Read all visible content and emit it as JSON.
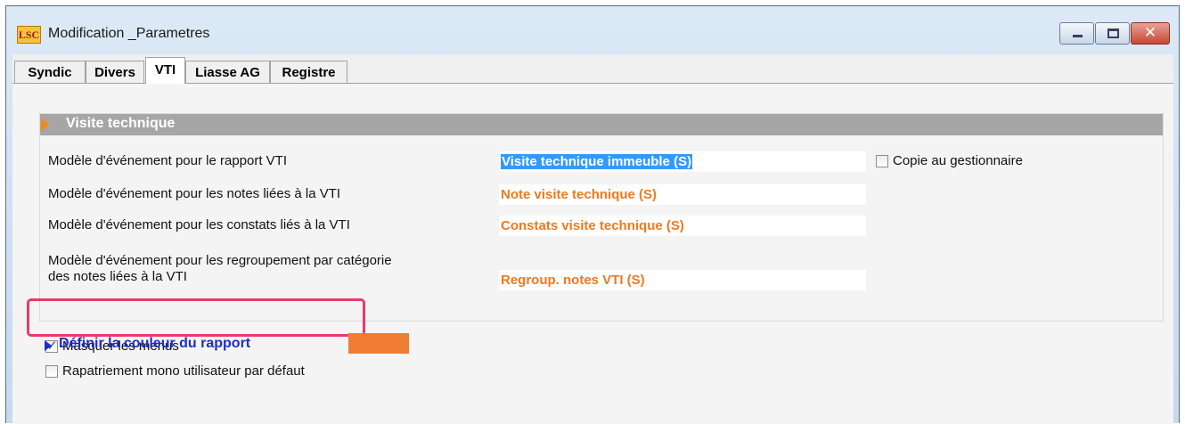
{
  "window": {
    "app_icon_text": "LSC",
    "title": "Modification _Parametres"
  },
  "tabs": [
    {
      "label": "Syndic",
      "active": false
    },
    {
      "label": "Divers",
      "active": false
    },
    {
      "label": "VTI",
      "active": true
    },
    {
      "label": "Liasse AG",
      "active": false
    },
    {
      "label": "Registre",
      "active": false
    }
  ],
  "section": {
    "title": "Visite technique",
    "rows": [
      {
        "label": "Modèle d'événement pour le rapport VTI",
        "value": "Visite technique immeuble (S)"
      },
      {
        "label": "Modèle d'événement pour les notes liées à la VTI",
        "value": "Note visite technique (S)"
      },
      {
        "label": "Modèle d'événement pour les constats liés à la VTI",
        "value": "Constats visite technique (S)"
      },
      {
        "label_line1": "Modèle d'événement pour les regroupement par catégorie",
        "label_line2": "des notes liées à la VTI",
        "value": "Regroup. notes VTI (S)"
      }
    ],
    "copy_manager": {
      "label": "Copie au gestionnaire",
      "checked": false
    }
  },
  "options": {
    "hide_menus": {
      "label": "Masquer les menus",
      "checked": true
    },
    "single_user_repatriation": {
      "label": "Rapatriement mono utilisateur par défaut",
      "checked": false
    }
  },
  "report_color": {
    "link_label": "Définir la couleur du rapport",
    "color": "#f07b32"
  },
  "colors": {
    "accent_orange": "#f0791e",
    "highlight_pink": "#e8396a",
    "link_blue": "#1a30c8",
    "header_gray": "#a6a6a6"
  }
}
